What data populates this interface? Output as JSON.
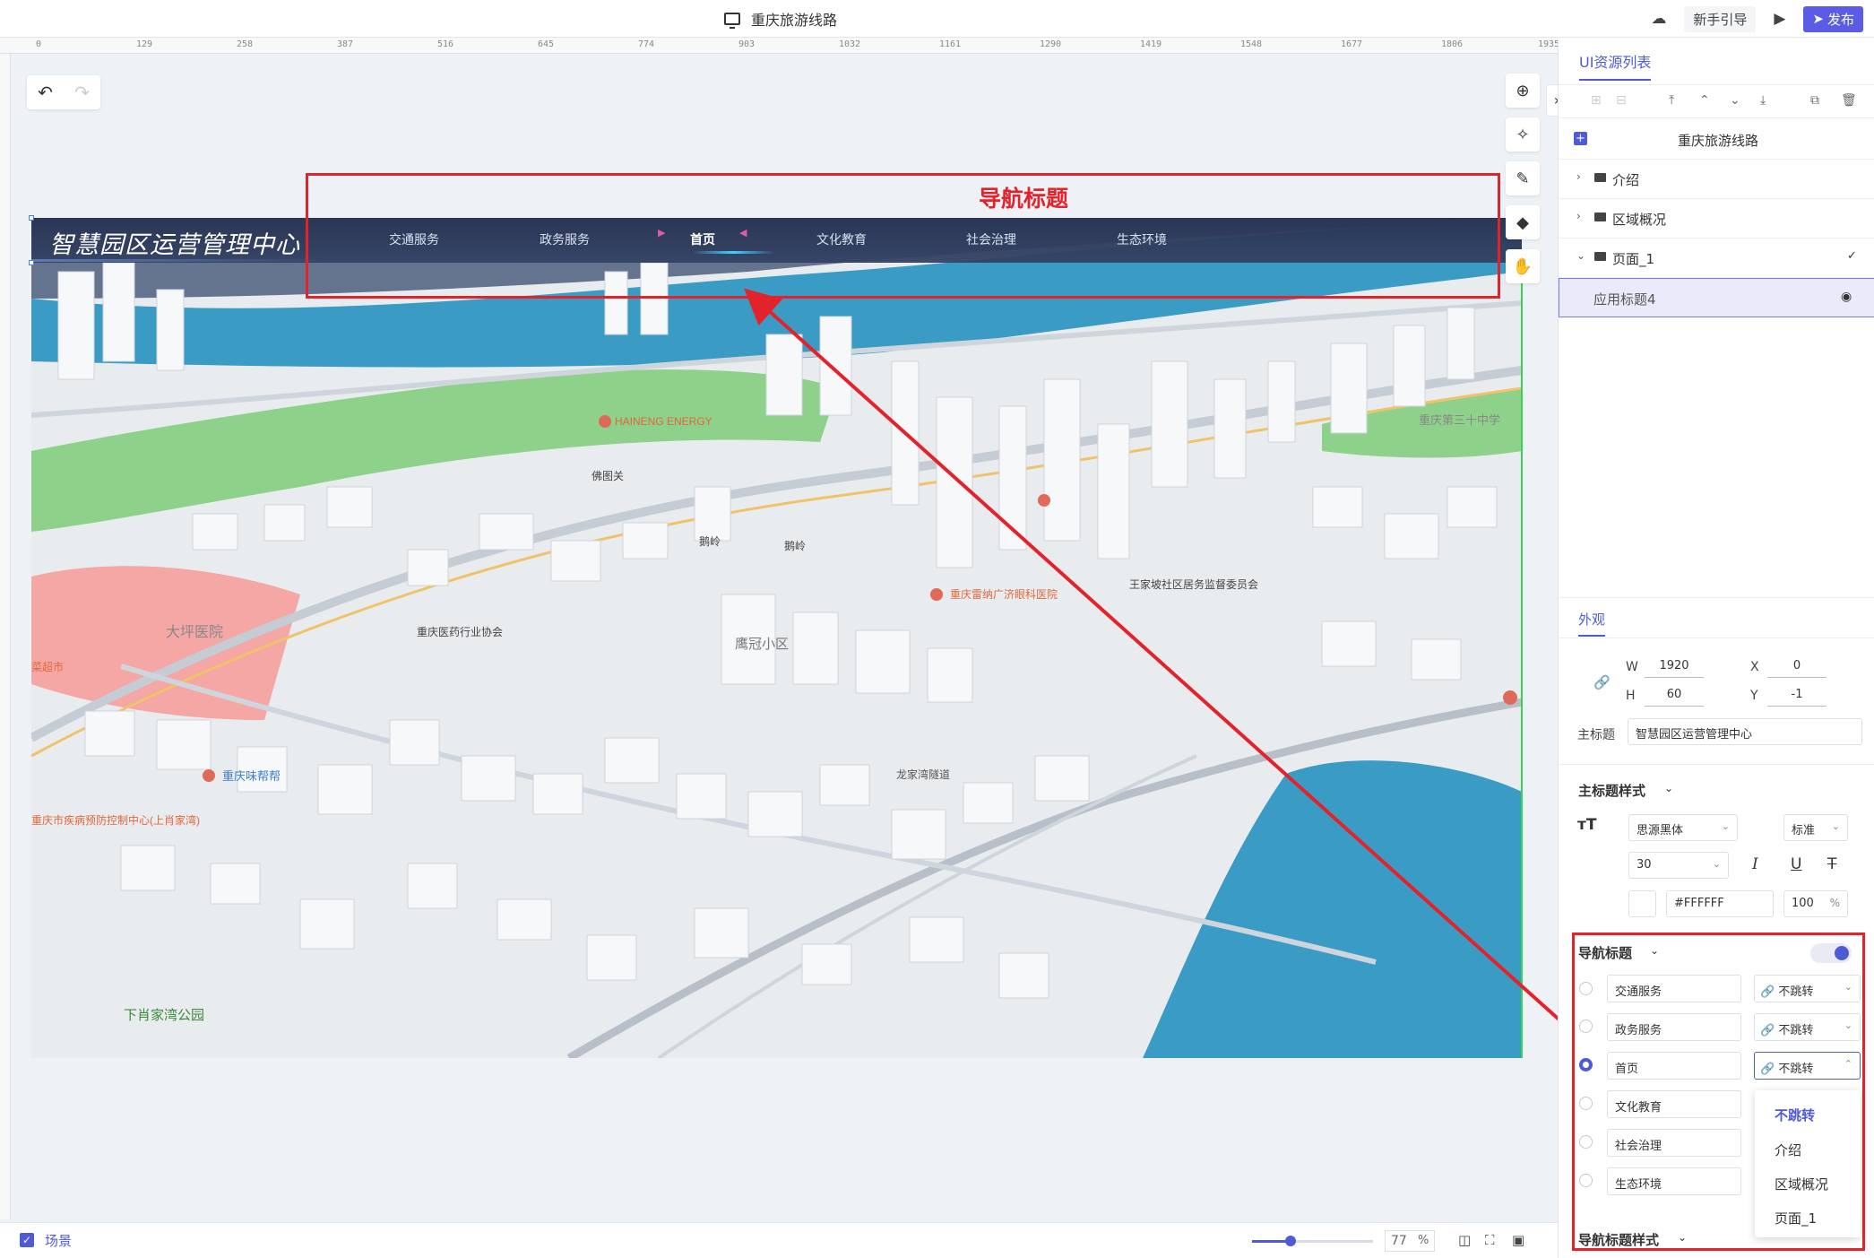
{
  "topbar": {
    "project_title": "重庆旅游线路",
    "guide_label": "新手引导",
    "publish_label": "发布"
  },
  "ruler": {
    "ticks": [
      "0",
      "129",
      "258",
      "387",
      "516",
      "645",
      "774",
      "903",
      "1032",
      "1161",
      "1290",
      "1419",
      "1548",
      "1677",
      "1806",
      "1935"
    ]
  },
  "navbar": {
    "app_title": "智慧园区运营管理中心",
    "items": [
      "交通服务",
      "政务服务",
      "首页",
      "文化教育",
      "社会治理",
      "生态环境"
    ],
    "active_index": 2
  },
  "annotation": {
    "label": "导航标题"
  },
  "map_labels": {
    "l1": "HAINENG ENERGY",
    "l2": "佛图关",
    "l3": "鹅岭",
    "l4": "鹅岭",
    "l5": "重庆医药行业协会",
    "l6": "鹰冠小区",
    "l7": "大坪医院",
    "l8": "重庆味帮帮",
    "l9": "重庆雷纳广济眼科医院",
    "l10": "王家坡社区居务监督委员会",
    "l11": "下肖家湾公园",
    "l12": "重庆市疾病预防控制中心(上肖家湾)",
    "l13": "重庆第三十中学",
    "l14": "菜超市",
    "l15": "龙家湾隧道"
  },
  "bottombar": {
    "scene_label": "场景",
    "zoom_value": "77",
    "zoom_unit": "%",
    "zoom_level": 0.3
  },
  "panel": {
    "list_tab": "UI资源列表",
    "tree": {
      "root": "重庆旅游线路",
      "items": [
        "介绍",
        "区域概况",
        "页面_1"
      ],
      "selected_child": "应用标题4"
    },
    "appearance_tab": "外观",
    "size": {
      "w_label": "W",
      "w": "1920",
      "h_label": "H",
      "h": "60",
      "x_label": "X",
      "x": "0",
      "y_label": "Y",
      "y": "-1"
    },
    "main_title_label": "主标题",
    "main_title_value": "智慧园区运营管理中心",
    "main_title_style_label": "主标题样式",
    "font_family": "思源黑体",
    "font_weight": "标准",
    "font_size": "30",
    "color_hex": "#FFFFFF",
    "opacity": "100",
    "opacity_unit": "%",
    "nav_title_label": "导航标题",
    "nav_items": [
      "交通服务",
      "政务服务",
      "首页",
      "文化教育",
      "社会治理",
      "生态环境"
    ],
    "jump_value": "不跳转",
    "dropdown_options": [
      "不跳转",
      "介绍",
      "区域概况",
      "页面_1"
    ],
    "nav_style_label": "导航标题样式"
  },
  "colors": {
    "accent": "#4f5bd5",
    "annotation": "#e3232b",
    "water": "#3a9cc4",
    "park": "#8ed18a"
  }
}
